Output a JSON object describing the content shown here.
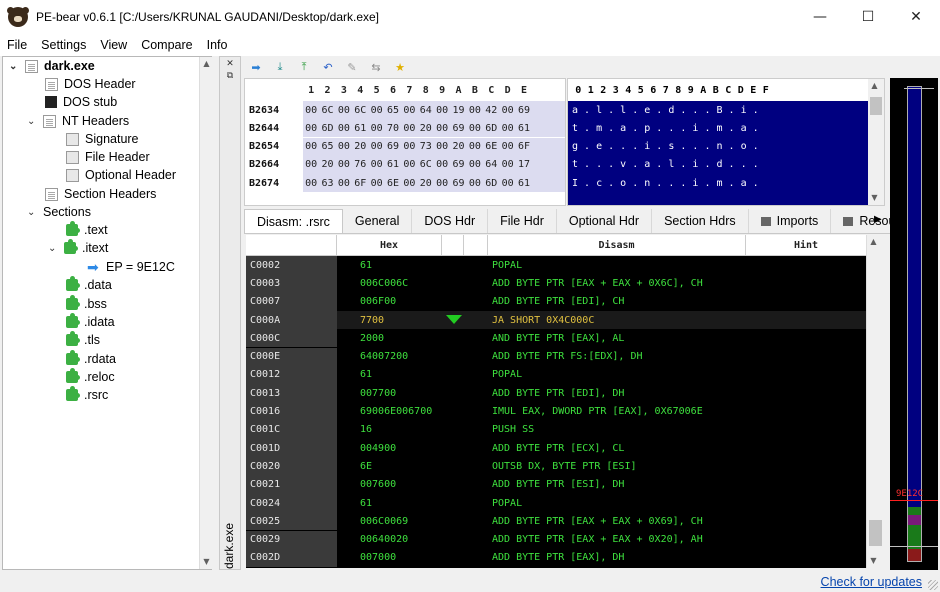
{
  "window": {
    "title": "PE-bear v0.6.1 [C:/Users/KRUNAL GAUDANI/Desktop/dark.exe]",
    "controls": {
      "minimize": "—",
      "maximize": "☐",
      "close": "✕"
    }
  },
  "menu": [
    "File",
    "Settings",
    "View",
    "Compare",
    "Info"
  ],
  "tree": {
    "root": "dark.exe",
    "items": [
      {
        "label": "DOS Header",
        "icon": "file-icon"
      },
      {
        "label": "DOS stub",
        "icon": "exe-icon"
      },
      {
        "label": "NT Headers",
        "icon": "file-icon"
      },
      {
        "label": "Signature",
        "icon": "file-icon"
      },
      {
        "label": "File Header",
        "icon": "file-icon"
      },
      {
        "label": "Optional Header",
        "icon": "file-icon"
      },
      {
        "label": "Section Headers",
        "icon": "file-icon"
      },
      {
        "label": "Sections",
        "icon": ""
      },
      {
        "label": ".text",
        "icon": "puzzle-icon"
      },
      {
        "label": ".itext",
        "icon": "puzzle-icon"
      },
      {
        "label": "EP = 9E12C",
        "icon": "arrow-right-icon"
      },
      {
        "label": ".data",
        "icon": "puzzle-icon"
      },
      {
        "label": ".bss",
        "icon": "puzzle-icon"
      },
      {
        "label": ".idata",
        "icon": "puzzle-icon"
      },
      {
        "label": ".tls",
        "icon": "puzzle-icon"
      },
      {
        "label": ".rdata",
        "icon": "puzzle-icon"
      },
      {
        "label": ".reloc",
        "icon": "puzzle-icon"
      },
      {
        "label": ".rsrc",
        "icon": "puzzle-icon"
      }
    ]
  },
  "dock": {
    "label": "dark.exe"
  },
  "hex": {
    "columns": [
      "1",
      "2",
      "3",
      "4",
      "5",
      "6",
      "7",
      "8",
      "9",
      "A",
      "B",
      "C",
      "D",
      "E"
    ],
    "rows": [
      {
        "offset": "B2634",
        "bytes": [
          "00",
          "6C",
          "00",
          "6C",
          "00",
          "65",
          "00",
          "64",
          "00",
          "19",
          "00",
          "42",
          "00",
          "69"
        ]
      },
      {
        "offset": "B2644",
        "bytes": [
          "00",
          "6D",
          "00",
          "61",
          "00",
          "70",
          "00",
          "20",
          "00",
          "69",
          "00",
          "6D",
          "00",
          "61"
        ]
      },
      {
        "offset": "B2654",
        "bytes": [
          "00",
          "65",
          "00",
          "20",
          "00",
          "69",
          "00",
          "73",
          "00",
          "20",
          "00",
          "6E",
          "00",
          "6F"
        ]
      },
      {
        "offset": "B2664",
        "bytes": [
          "00",
          "20",
          "00",
          "76",
          "00",
          "61",
          "00",
          "6C",
          "00",
          "69",
          "00",
          "64",
          "00",
          "17"
        ]
      },
      {
        "offset": "B2674",
        "bytes": [
          "00",
          "63",
          "00",
          "6F",
          "00",
          "6E",
          "00",
          "20",
          "00",
          "69",
          "00",
          "6D",
          "00",
          "61"
        ]
      }
    ]
  },
  "ascii": {
    "columns": [
      "0",
      "1",
      "2",
      "3",
      "4",
      "5",
      "6",
      "7",
      "8",
      "9",
      "A",
      "B",
      "C",
      "D",
      "E",
      "F"
    ],
    "rows": [
      "a . l . l . e . d . . . B . i .",
      "t . m . a . p . . . i . m . a .",
      "g . e . . . i . s . . . n . o .",
      "t . . . v . a . l . i . d . . .",
      "I . c . o . n . . . i . m . a ."
    ]
  },
  "tabs": [
    "Disasm: .rsrc",
    "General",
    "DOS Hdr",
    "File Hdr",
    "Optional Hdr",
    "Section Hdrs",
    "Imports",
    "Resou"
  ],
  "disasm": {
    "headers": {
      "hex": "Hex",
      "disasm": "Disasm",
      "hint": "Hint"
    },
    "rows": [
      {
        "addr": "C0002",
        "hex": "61",
        "asm": "POPAL"
      },
      {
        "addr": "C0003",
        "hex": "006C006C",
        "asm": "ADD BYTE PTR [EAX + EAX + 0X6C], CH"
      },
      {
        "addr": "C0007",
        "hex": "006F00",
        "asm": "ADD BYTE PTR [EDI], CH"
      },
      {
        "addr": "C000A",
        "hex": "7700",
        "asm": "JA SHORT 0X4C000C",
        "selected": true
      },
      {
        "addr": "C000C",
        "hex": "2000",
        "asm": "AND BYTE PTR [EAX], AL"
      },
      {
        "addr": "C000E",
        "hex": "64007200",
        "asm": "ADD BYTE PTR FS:[EDX], DH"
      },
      {
        "addr": "C0012",
        "hex": "61",
        "asm": "POPAL"
      },
      {
        "addr": "C0013",
        "hex": "007700",
        "asm": "ADD BYTE PTR [EDI], DH"
      },
      {
        "addr": "C0016",
        "hex": "69006E006700",
        "asm": "IMUL EAX, DWORD PTR [EAX], 0X67006E"
      },
      {
        "addr": "C001C",
        "hex": "16",
        "asm": "PUSH SS"
      },
      {
        "addr": "C001D",
        "hex": "004900",
        "asm": "ADD BYTE PTR [ECX], CL"
      },
      {
        "addr": "C0020",
        "hex": "6E",
        "asm": "OUTSB DX, BYTE PTR [ESI]"
      },
      {
        "addr": "C0021",
        "hex": "007600",
        "asm": "ADD BYTE PTR [ESI], DH"
      },
      {
        "addr": "C0024",
        "hex": "61",
        "asm": "POPAL"
      },
      {
        "addr": "C0025",
        "hex": "006C0069",
        "asm": "ADD BYTE PTR [EAX + EAX + 0X69], CH"
      },
      {
        "addr": "C0029",
        "hex": "00640020",
        "asm": "ADD BYTE PTR [EAX + EAX + 0X20], AH"
      },
      {
        "addr": "C002D",
        "hex": "007000",
        "asm": "ADD BYTE PTR [EAX], DH"
      }
    ]
  },
  "sidemap": {
    "marker_label": "9E12C"
  },
  "status": {
    "link": "Check for updates"
  },
  "colors": {
    "accent": "#000080",
    "code_green": "#3ee03e",
    "selected_yellow": "#e0c040"
  }
}
